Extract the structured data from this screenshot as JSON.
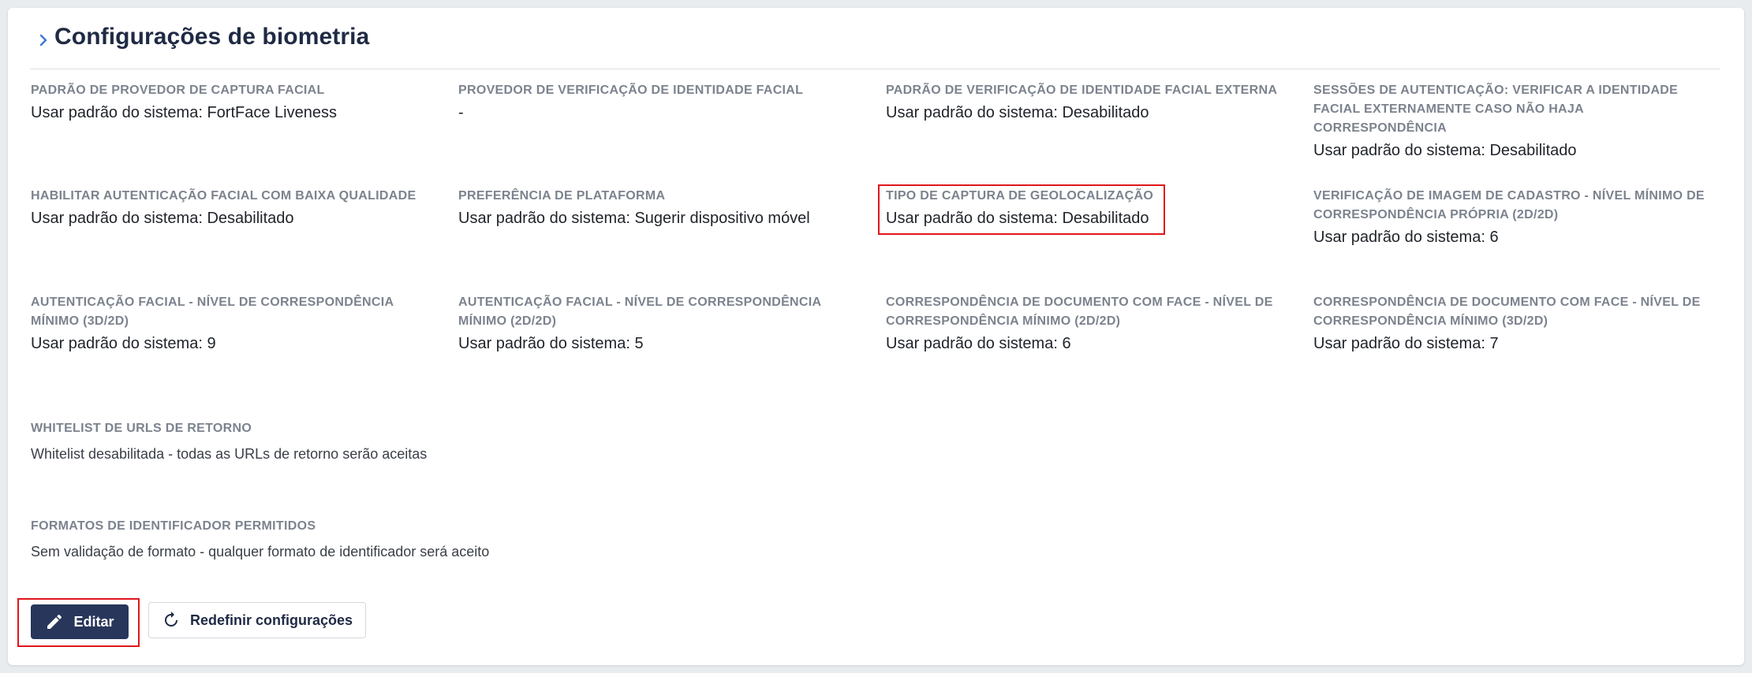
{
  "page": {
    "title": "Configurações de biometria"
  },
  "fields": [
    {
      "label": "Padrão de provedor de captura facial",
      "value": "Usar padrão do sistema: FortFace Liveness"
    },
    {
      "label": "Provedor de verificação de identidade facial",
      "value": "-"
    },
    {
      "label": "Padrão de verificação de identidade facial externa",
      "value": "Usar padrão do sistema: Desabilitado"
    },
    {
      "label": "Sessões de autenticação: verificar a identidade facial externamente caso não haja correspondência",
      "value": "Usar padrão do sistema: Desabilitado"
    },
    {
      "label": "Habilitar autenticação facial com baixa qualidade",
      "value": "Usar padrão do sistema: Desabilitado"
    },
    {
      "label": "Preferência de plataforma",
      "value": "Usar padrão do sistema: Sugerir dispositivo móvel"
    },
    {
      "label": "Tipo de captura de geolocalização",
      "value": "Usar padrão do sistema: Desabilitado"
    },
    {
      "label": "Verificação de imagem de cadastro - nível mínimo de correspondência própria (2D/2D)",
      "value": "Usar padrão do sistema: 6"
    },
    {
      "label": "Autenticação facial - nível de correspondência mínimo (3D/2D)",
      "value": "Usar padrão do sistema: 9"
    },
    {
      "label": "Autenticação facial - nível de correspondência mínimo (2D/2D)",
      "value": "Usar padrão do sistema: 5"
    },
    {
      "label": "Correspondência de documento com face - nível de correspondência mínimo (2D/2D)",
      "value": "Usar padrão do sistema: 6"
    },
    {
      "label": "Correspondência de documento com face - nível de correspondência mínimo (3D/2D)",
      "value": "Usar padrão do sistema: 7"
    },
    {
      "label": "Whitelist de URLs de retorno",
      "value": "Whitelist desabilitada - todas as URLs de retorno serão aceitas"
    },
    {
      "label": "Formatos de identificador permitidos",
      "value": "Sem validação de formato - qualquer formato de identificador será aceito"
    }
  ],
  "buttons": {
    "edit_label": "Editar",
    "reset_label": "Redefinir configurações"
  },
  "icons": {
    "header": "chevron-right-icon",
    "edit": "pencil-icon",
    "reset": "refresh-icon"
  },
  "colors": {
    "primary": "#27365a",
    "highlight": "#e0161b",
    "chevron": "#3a7bd5"
  }
}
